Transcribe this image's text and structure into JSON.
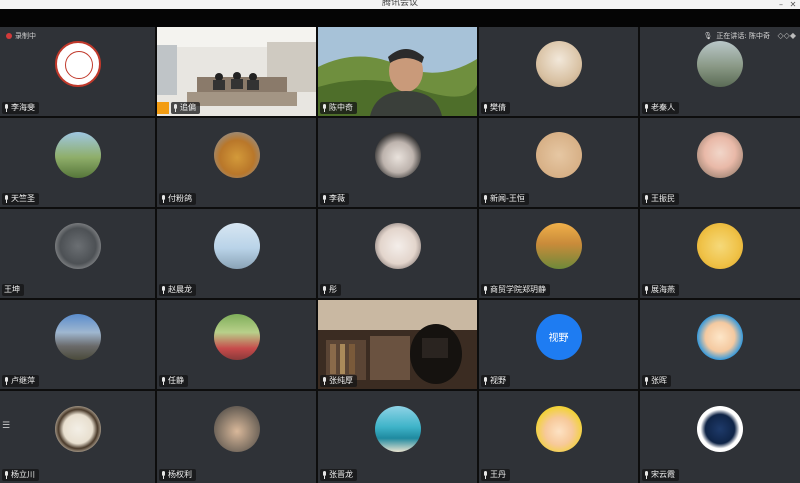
{
  "window": {
    "title": "腾讯会议",
    "min": "–",
    "close": "✕"
  },
  "recording": {
    "label": "录制中"
  },
  "speaker": {
    "label": "正在讲话: 陈中奇"
  },
  "participants": [
    [
      "李海斐",
      "追偏",
      "陈中奇",
      "樊倩",
      "老秦人"
    ],
    [
      "天竺圣",
      "付粉鸽",
      "李薇",
      "新闻-王恒",
      "王振民"
    ],
    [
      "王坤",
      "赵晨龙",
      "彤",
      "商贸学院郑玥静",
      "展海燕"
    ],
    [
      "卢继萍",
      "任静",
      "张纯厚",
      "视野",
      "张晖"
    ],
    [
      "杨立川",
      "杨权利",
      "张晋龙",
      "王丹",
      "宋云霞"
    ]
  ],
  "avatar_text": {
    "shiye": "视野"
  },
  "colors": {
    "tile": "#2f3237",
    "active_speaker": "#f39c12",
    "record_dot": "#d23a3a"
  }
}
